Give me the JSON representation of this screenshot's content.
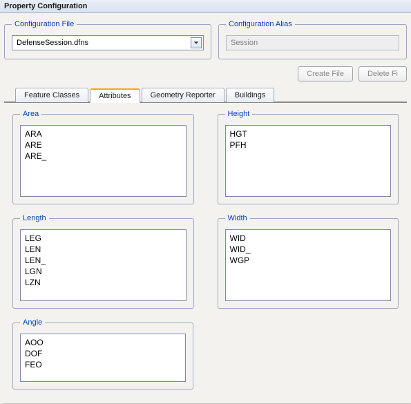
{
  "title": "Property Configuration",
  "configFile": {
    "legend": "Configuration File",
    "value": "DefenseSession.dfns"
  },
  "configAlias": {
    "legend": "Configuration Alias",
    "value": "Session"
  },
  "buttons": {
    "create": "Create File",
    "delete": "Delete Fi"
  },
  "tabs": {
    "featureClasses": "Feature Classes",
    "attributes": "Attributes",
    "geometryReporter": "Geometry Reporter",
    "buildings": "Buildings"
  },
  "groups": {
    "area": {
      "legend": "Area",
      "items": [
        "ARA",
        "ARE",
        "ARE_"
      ]
    },
    "height": {
      "legend": "Height",
      "items": [
        "HGT",
        "PFH"
      ]
    },
    "length": {
      "legend": "Length",
      "items": [
        "LEG",
        "LEN",
        "LEN_",
        "LGN",
        "LZN"
      ]
    },
    "width": {
      "legend": "Width",
      "items": [
        "WID",
        "WID_",
        "WGP"
      ]
    },
    "angle": {
      "legend": "Angle",
      "items": [
        "AOO",
        "DOF",
        "FEO"
      ]
    }
  }
}
